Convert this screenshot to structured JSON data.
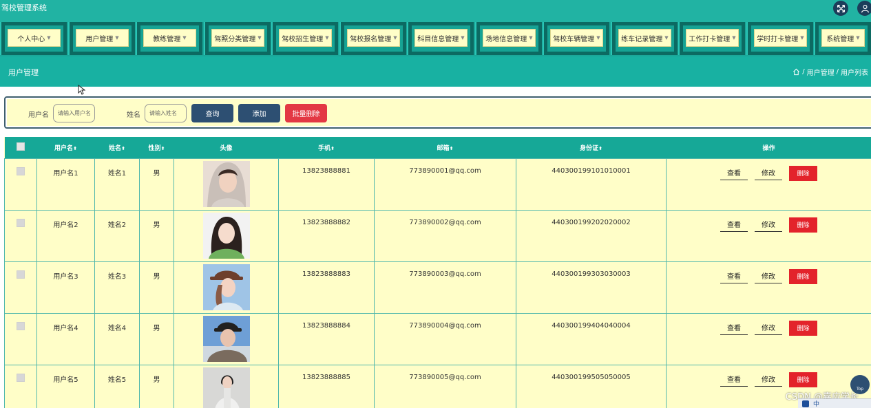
{
  "app": {
    "title": "驾校管理系统"
  },
  "header_icons": [
    {
      "icon": "fullscreen-icon"
    },
    {
      "icon": "user-icon"
    }
  ],
  "menu": [
    {
      "label": "个人中心"
    },
    {
      "label": "用户管理"
    },
    {
      "label": "教练管理"
    },
    {
      "label": "驾照分类管理"
    },
    {
      "label": "驾校招生管理"
    },
    {
      "label": "驾校报名管理"
    },
    {
      "label": "科目信息管理"
    },
    {
      "label": "场地信息管理"
    },
    {
      "label": "驾校车辆管理"
    },
    {
      "label": "练车记录管理"
    },
    {
      "label": "工作打卡管理"
    },
    {
      "label": "学时打卡管理"
    },
    {
      "label": "系统管理"
    }
  ],
  "page": {
    "title": "用户管理",
    "breadcrumb": [
      "用户管理",
      "用户列表"
    ],
    "breadcrumb_sep": " / "
  },
  "search": {
    "username_label": "用户名",
    "username_placeholder": "请输入用户名",
    "name_label": "姓名",
    "name_placeholder": "请输入姓名",
    "query_button": "查询",
    "add_button": "添加",
    "batch_delete_button": "批量删除"
  },
  "table": {
    "columns": [
      "用户名",
      "姓名",
      "性别",
      "头像",
      "手机",
      "邮箱",
      "身份证",
      "操作"
    ],
    "sortable_mark": "⬍",
    "rows": [
      {
        "username": "用户名1",
        "name": "姓名1",
        "gender": "男",
        "phone": "13823888881",
        "email": "773890001@qq.com",
        "idcard": "440300199101010001"
      },
      {
        "username": "用户名2",
        "name": "姓名2",
        "gender": "男",
        "phone": "13823888882",
        "email": "773890002@qq.com",
        "idcard": "440300199202020002"
      },
      {
        "username": "用户名3",
        "name": "姓名3",
        "gender": "男",
        "phone": "13823888883",
        "email": "773890003@qq.com",
        "idcard": "440300199303030003"
      },
      {
        "username": "用户名4",
        "name": "姓名4",
        "gender": "男",
        "phone": "13823888884",
        "email": "773890004@qq.com",
        "idcard": "440300199404040004"
      },
      {
        "username": "用户名5",
        "name": "姓名5",
        "gender": "男",
        "phone": "13823888885",
        "email": "773890005@qq.com",
        "idcard": "440300199505050005"
      }
    ],
    "actions": {
      "view": "查看",
      "edit": "修改",
      "delete": "删除"
    }
  },
  "overlay": {
    "watermark": "CSDN @嘉应学长",
    "top_button": "Top",
    "tray_text": "中"
  },
  "colors": {
    "teal": "#18b1a2",
    "dark_teal": "#0c6a62",
    "cream": "#fffec8",
    "navy": "#2d4f72",
    "red": "#e3232b"
  }
}
